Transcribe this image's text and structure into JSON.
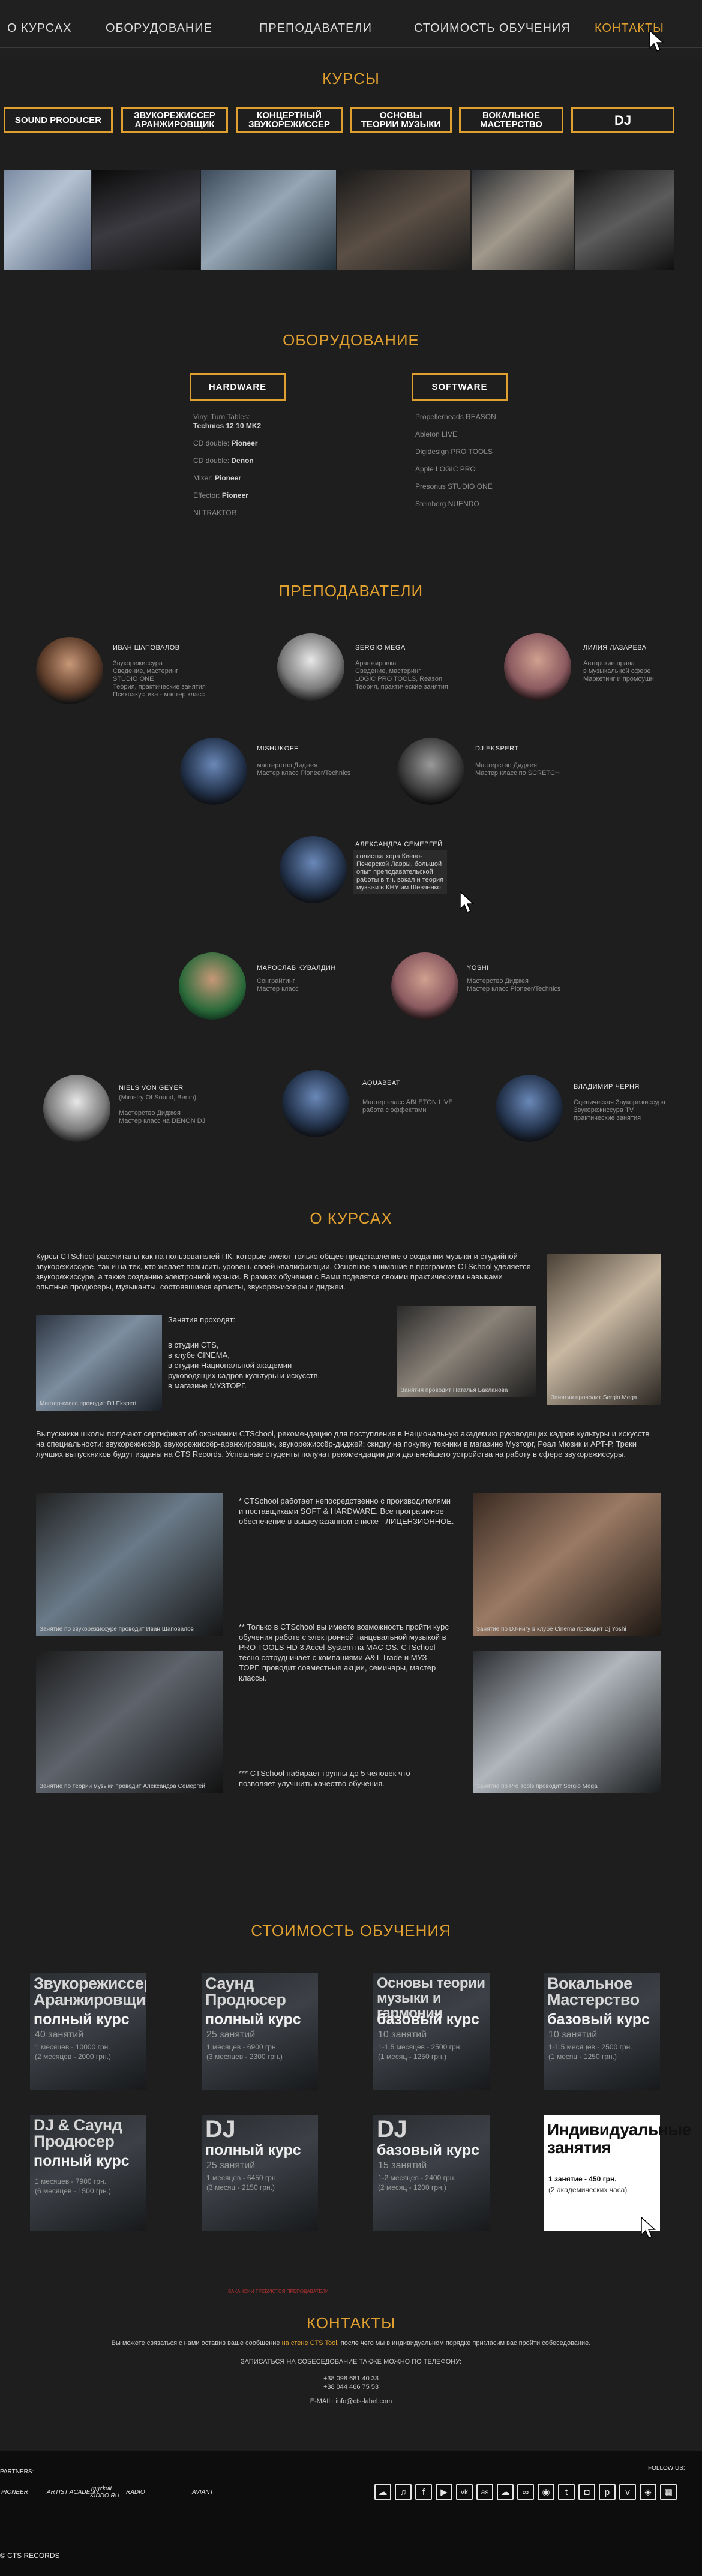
{
  "nav": {
    "items": [
      "О КУРСАХ",
      "ОБОРУДОВАНИЕ",
      "ПРЕПОДАВАТЕЛИ",
      "СТОИМОСТЬ ОБУЧЕНИЯ",
      "КОНТАКТЫ"
    ],
    "active_index": 4,
    "accent_color": "#e0a030"
  },
  "courses": {
    "title": "КУРСЫ",
    "buttons": [
      "SOUND PRODUCER",
      "ЗВУКОРЕЖИССЕР АРАНЖИРОВЩИК",
      "КОНЦЕРТНЫЙ ЗВУКОРЕЖИССЕР",
      "ОСНОВЫ ТЕОРИИ МУЗЫКИ",
      "ВОКАЛЬНОЕ МАСТЕРСТВО",
      "DJ"
    ]
  },
  "equipment": {
    "title": "ОБОРУДОВАНИЕ",
    "hardware_label": "HARDWARE",
    "software_label": "SOFTWARE",
    "hardware": [
      {
        "label": "Vinyl Turn Tables:",
        "value": "Technics 12 10 MK2"
      },
      {
        "label": "CD double:",
        "value": "Pioneer"
      },
      {
        "label": "CD double:",
        "value": "Denon"
      },
      {
        "label": "Mixer:",
        "value": "Pioneer"
      },
      {
        "label": "Effector:",
        "value": "Pioneer"
      },
      {
        "label": "NI TRAKTOR",
        "value": ""
      }
    ],
    "software": [
      "Propellerheads REASON",
      "Ableton LIVE",
      "Digidesign PRO TOOLS",
      "Apple LOGIC PRO",
      "Presonus STUDIO ONE",
      "Steinberg NUENDO"
    ]
  },
  "teachers": {
    "title": "ПРЕПОДАВАТЕЛИ",
    "list": [
      {
        "name": "ИВАН ШАПОВАЛОВ",
        "desc": "Звукорежиссура\nСведение, мастеринг\nSTUDIO ONE\nТеория, практические занятия\nПсихоакустика - мастер класс"
      },
      {
        "name": "SERGIO MEGA",
        "desc": "Аранжировка\nСведение, мастеринг\nLOGIC PRO TOOLS, Reason\nТеория, практические занятия"
      },
      {
        "name": "ЛИЛИЯ ЛАЗАРЕВА",
        "desc": "Авторские права\nв музыкальной сфере\nМаркетинг и промоушн"
      },
      {
        "name": "MISHUKOFF",
        "desc": "мастерство Диджея\nМастер класс Pioneer/Technics"
      },
      {
        "name": "DJ EKSPERT",
        "desc": "Мастерство Диджея\nМастер класс по SCRETCH"
      },
      {
        "name": "АЛЕКСАНДРА СЕМЕРГЕЙ",
        "desc": "солистка хора Киево-\nПечерской Лавры, большой\nопыт преподавательской\nработы в т.ч. вокал и теория\nмузыки в КНУ им Шевченко"
      },
      {
        "name": "МАРОСЛАВ КУВАЛДИН",
        "desc": "Сонграйтинг\nМастер класс"
      },
      {
        "name": "YOSHI",
        "desc": "Мастерство Диджея\nМастер класс Pioneer/Technics"
      },
      {
        "name": "NIELS VON GEYER",
        "desc": "(Ministry Of Sound, Berlin)\n\nМастерство Диджея\nМастер класс на DENON DJ"
      },
      {
        "name": "AQUABEAT",
        "desc": "Мастер класс ABLETON LIVE\nработа с эффектами"
      },
      {
        "name": "ВЛАДИМИР ЧЕРНЯ",
        "desc": "Сценическая Звукорежиссура\nЗвукорежиссура TV\nпрактические занятия"
      }
    ]
  },
  "about": {
    "title": "О КУРСАХ",
    "intro": "Курсы CTSchool рассчитаны как на пользователей ПК, которые имеют только общее представление о создании музыки и студийной звукорежиссуре, так и на тех, кто желает повысить уровень своей квалификации. Основное внимание в программе CTSchool уделяется звукорежиссуре, а также созданию электронной музыки. В рамках обучения с Вами поделятся своими практическими навыками опытные продюсеры, музыканты, состоявшиеся артисты, звукорежиссеры и диджеи.",
    "lessons_title": "Занятия проходят:",
    "lessons": [
      "в студии CTS,",
      "в клубе CINEMA,",
      "в студии Национальной академии руководящих кадров культуры и искусств,",
      "в магазине МУЗТОРГ."
    ],
    "graduates": "Выпускники школы получают сертификат об окончании CTSchool, рекомендацию для поступления в Национальную академию руководящих кадров культуры и искусств на специальности: звукорежиссёр, звукорежиссёр-аранжировщик, звукорежиссёр-диджей; скидку на покупку техники в магазине Музторг, Реал Мюзик и АРТ-Р. Треки лучших выпускников будут изданы на CTS Records. Успешные студенты получат рекомендации для дальнейшего устройства на работу в сфере звукорежиссуры.",
    "note1": "* CTSchool работает непосредственно с производителями и поставщиками SOFT & HARDWARE. Все программное обеспечение в вышеуказанном списке - ЛИЦЕНЗИОННОЕ.",
    "note2": "** Только в CTSchool вы имеете возможность пройти курс обучения работе с электронной танцевальной музыкой в PRO TOOLS HD 3 Accel System на MAC OS. CTSchool тесно сотрудничает с компаниями A&T Trade и МУЗ ТОРГ, проводит совместные акции, семинары, мастер классы.",
    "note3": "*** CTSchool набирает группы до 5 человек что позволяет улучшить качество обучения.",
    "captions": [
      "Мастер-класс проводит DJ Ekspert",
      "Занятия проводит Наталья Бакланова",
      "Занятия проводит Sergio Mega",
      "Занятие по звукорежиссуре проводит Иван Шаповалов",
      "Занятие по DJ-ингу в клубе Cinema проводит Dj Yoshi",
      "Занятие по теории музыки проводит Александра Семергей",
      "Занятие по Pro Tools проводит Sergio Mega"
    ]
  },
  "prices": {
    "title": "СТОИМОСТЬ ОБУЧЕНИЯ",
    "cards": [
      {
        "title": "Звукорежиссер Аранжировщик",
        "sub": "полный курс",
        "count": "40 занятий",
        "p1": "1 месяцев - 10000 грн.",
        "p2": "(2 месяцев - 2000 грн.)"
      },
      {
        "title": "Саунд Продюсер",
        "sub": "полный курс",
        "count": "25 занятий",
        "p1": "1 месяцев - 6900 грн.",
        "p2": "(3 месяцев - 2300 грн.)"
      },
      {
        "title": "Основы теории музыки и гармонии",
        "sub": "базовый курс",
        "count": "10 занятий",
        "p1": "1-1.5 месяцев - 2500 грн.",
        "p2": "(1 месяц - 1250 грн.)"
      },
      {
        "title": "Вокальное Мастерство",
        "sub": "базовый курс",
        "count": "10 занятий",
        "p1": "1-1.5 месяцев - 2500 грн.",
        "p2": "(1 месяц - 1250 грн.)"
      },
      {
        "title": "DJ & Саунд Продюсер",
        "sub": "полный курс",
        "count": "",
        "p1": "1 месяцев - 7900 грн.",
        "p2": "(6 месяцев - 1500 грн.)"
      },
      {
        "title": "DJ",
        "sub": "полный курс",
        "count": "25 занятий",
        "p1": "1 месяцев - 6450 грн.",
        "p2": "(3 месяц - 2150 грн.)"
      },
      {
        "title": "DJ",
        "sub": "базовый курс",
        "count": "15 занятий",
        "p1": "1-2 месяцев - 2400 грн.",
        "p2": "(2 месяц - 1200 грн.)"
      },
      {
        "title": "Индивидуальные занятия",
        "sub": "",
        "count": "",
        "p1": "1 занятие - 450 грн.",
        "p2": "(2 академических часа)"
      }
    ]
  },
  "contacts": {
    "title": "КОНТАКТЫ",
    "small_note": "ВАКАНСИИ ТРЕБУЮТСЯ ПРЕПОДАВАТЕЛИ",
    "line1_pre": "Вы можете связаться с нами оставив ваше сообщение",
    "line1_link": "на стене CTS Tool",
    "line1_post": ", после чего мы в индивидуальном порядке пригласим вас пройти собеседование.",
    "line2": "ЗАПИСАТЬСЯ НА СОБЕСЕДОВАНИЕ ТАКЖЕ МОЖНО ПО ТЕЛЕФОНУ:",
    "phone1": "+38 098 681 40 33",
    "phone2": "+38 044 466 75 53",
    "email": "E-MAIL: info@cts-label.com"
  },
  "footer": {
    "partners_label": "PARTNERS:",
    "partners": [
      "PIONEER",
      "ARTIST ACADEMY",
      "muzkult",
      "KIDDO RU",
      "RADIO",
      "AVIANT"
    ],
    "follow_label": "FOLLOW US:",
    "social_icons": [
      "soundcloud-icon",
      "music-icon",
      "facebook-icon",
      "youtube-icon",
      "vk-icon",
      "lastfm-icon",
      "soundcloud-2-icon",
      "mixcloud-icon",
      "rss-icon",
      "twitter-icon",
      "instagram-icon",
      "pinterest-icon",
      "vimeo-icon"
    ],
    "copyright": "© CTS RECORDS"
  }
}
